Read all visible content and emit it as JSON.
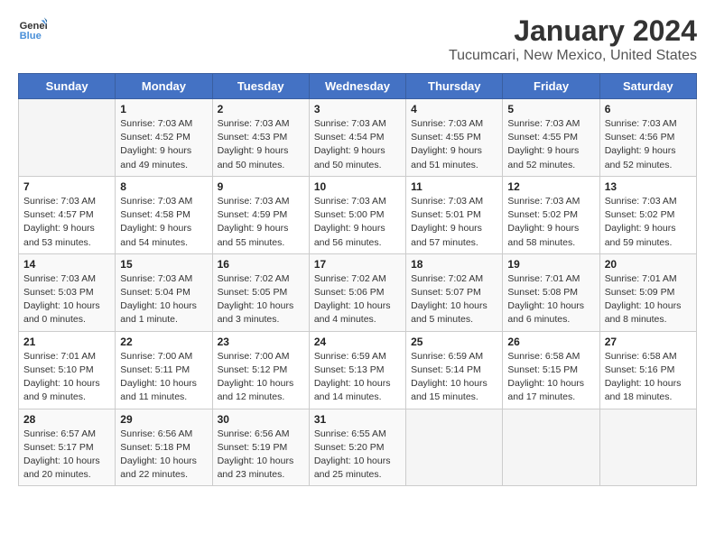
{
  "logo": {
    "line1": "General",
    "line2": "Blue"
  },
  "title": "January 2024",
  "subtitle": "Tucumcari, New Mexico, United States",
  "weekdays": [
    "Sunday",
    "Monday",
    "Tuesday",
    "Wednesday",
    "Thursday",
    "Friday",
    "Saturday"
  ],
  "weeks": [
    [
      {
        "day": "",
        "info": ""
      },
      {
        "day": "1",
        "info": "Sunrise: 7:03 AM\nSunset: 4:52 PM\nDaylight: 9 hours\nand 49 minutes."
      },
      {
        "day": "2",
        "info": "Sunrise: 7:03 AM\nSunset: 4:53 PM\nDaylight: 9 hours\nand 50 minutes."
      },
      {
        "day": "3",
        "info": "Sunrise: 7:03 AM\nSunset: 4:54 PM\nDaylight: 9 hours\nand 50 minutes."
      },
      {
        "day": "4",
        "info": "Sunrise: 7:03 AM\nSunset: 4:55 PM\nDaylight: 9 hours\nand 51 minutes."
      },
      {
        "day": "5",
        "info": "Sunrise: 7:03 AM\nSunset: 4:55 PM\nDaylight: 9 hours\nand 52 minutes."
      },
      {
        "day": "6",
        "info": "Sunrise: 7:03 AM\nSunset: 4:56 PM\nDaylight: 9 hours\nand 52 minutes."
      }
    ],
    [
      {
        "day": "7",
        "info": "Sunrise: 7:03 AM\nSunset: 4:57 PM\nDaylight: 9 hours\nand 53 minutes."
      },
      {
        "day": "8",
        "info": "Sunrise: 7:03 AM\nSunset: 4:58 PM\nDaylight: 9 hours\nand 54 minutes."
      },
      {
        "day": "9",
        "info": "Sunrise: 7:03 AM\nSunset: 4:59 PM\nDaylight: 9 hours\nand 55 minutes."
      },
      {
        "day": "10",
        "info": "Sunrise: 7:03 AM\nSunset: 5:00 PM\nDaylight: 9 hours\nand 56 minutes."
      },
      {
        "day": "11",
        "info": "Sunrise: 7:03 AM\nSunset: 5:01 PM\nDaylight: 9 hours\nand 57 minutes."
      },
      {
        "day": "12",
        "info": "Sunrise: 7:03 AM\nSunset: 5:02 PM\nDaylight: 9 hours\nand 58 minutes."
      },
      {
        "day": "13",
        "info": "Sunrise: 7:03 AM\nSunset: 5:02 PM\nDaylight: 9 hours\nand 59 minutes."
      }
    ],
    [
      {
        "day": "14",
        "info": "Sunrise: 7:03 AM\nSunset: 5:03 PM\nDaylight: 10 hours\nand 0 minutes."
      },
      {
        "day": "15",
        "info": "Sunrise: 7:03 AM\nSunset: 5:04 PM\nDaylight: 10 hours\nand 1 minute."
      },
      {
        "day": "16",
        "info": "Sunrise: 7:02 AM\nSunset: 5:05 PM\nDaylight: 10 hours\nand 3 minutes."
      },
      {
        "day": "17",
        "info": "Sunrise: 7:02 AM\nSunset: 5:06 PM\nDaylight: 10 hours\nand 4 minutes."
      },
      {
        "day": "18",
        "info": "Sunrise: 7:02 AM\nSunset: 5:07 PM\nDaylight: 10 hours\nand 5 minutes."
      },
      {
        "day": "19",
        "info": "Sunrise: 7:01 AM\nSunset: 5:08 PM\nDaylight: 10 hours\nand 6 minutes."
      },
      {
        "day": "20",
        "info": "Sunrise: 7:01 AM\nSunset: 5:09 PM\nDaylight: 10 hours\nand 8 minutes."
      }
    ],
    [
      {
        "day": "21",
        "info": "Sunrise: 7:01 AM\nSunset: 5:10 PM\nDaylight: 10 hours\nand 9 minutes."
      },
      {
        "day": "22",
        "info": "Sunrise: 7:00 AM\nSunset: 5:11 PM\nDaylight: 10 hours\nand 11 minutes."
      },
      {
        "day": "23",
        "info": "Sunrise: 7:00 AM\nSunset: 5:12 PM\nDaylight: 10 hours\nand 12 minutes."
      },
      {
        "day": "24",
        "info": "Sunrise: 6:59 AM\nSunset: 5:13 PM\nDaylight: 10 hours\nand 14 minutes."
      },
      {
        "day": "25",
        "info": "Sunrise: 6:59 AM\nSunset: 5:14 PM\nDaylight: 10 hours\nand 15 minutes."
      },
      {
        "day": "26",
        "info": "Sunrise: 6:58 AM\nSunset: 5:15 PM\nDaylight: 10 hours\nand 17 minutes."
      },
      {
        "day": "27",
        "info": "Sunrise: 6:58 AM\nSunset: 5:16 PM\nDaylight: 10 hours\nand 18 minutes."
      }
    ],
    [
      {
        "day": "28",
        "info": "Sunrise: 6:57 AM\nSunset: 5:17 PM\nDaylight: 10 hours\nand 20 minutes."
      },
      {
        "day": "29",
        "info": "Sunrise: 6:56 AM\nSunset: 5:18 PM\nDaylight: 10 hours\nand 22 minutes."
      },
      {
        "day": "30",
        "info": "Sunrise: 6:56 AM\nSunset: 5:19 PM\nDaylight: 10 hours\nand 23 minutes."
      },
      {
        "day": "31",
        "info": "Sunrise: 6:55 AM\nSunset: 5:20 PM\nDaylight: 10 hours\nand 25 minutes."
      },
      {
        "day": "",
        "info": ""
      },
      {
        "day": "",
        "info": ""
      },
      {
        "day": "",
        "info": ""
      }
    ]
  ]
}
